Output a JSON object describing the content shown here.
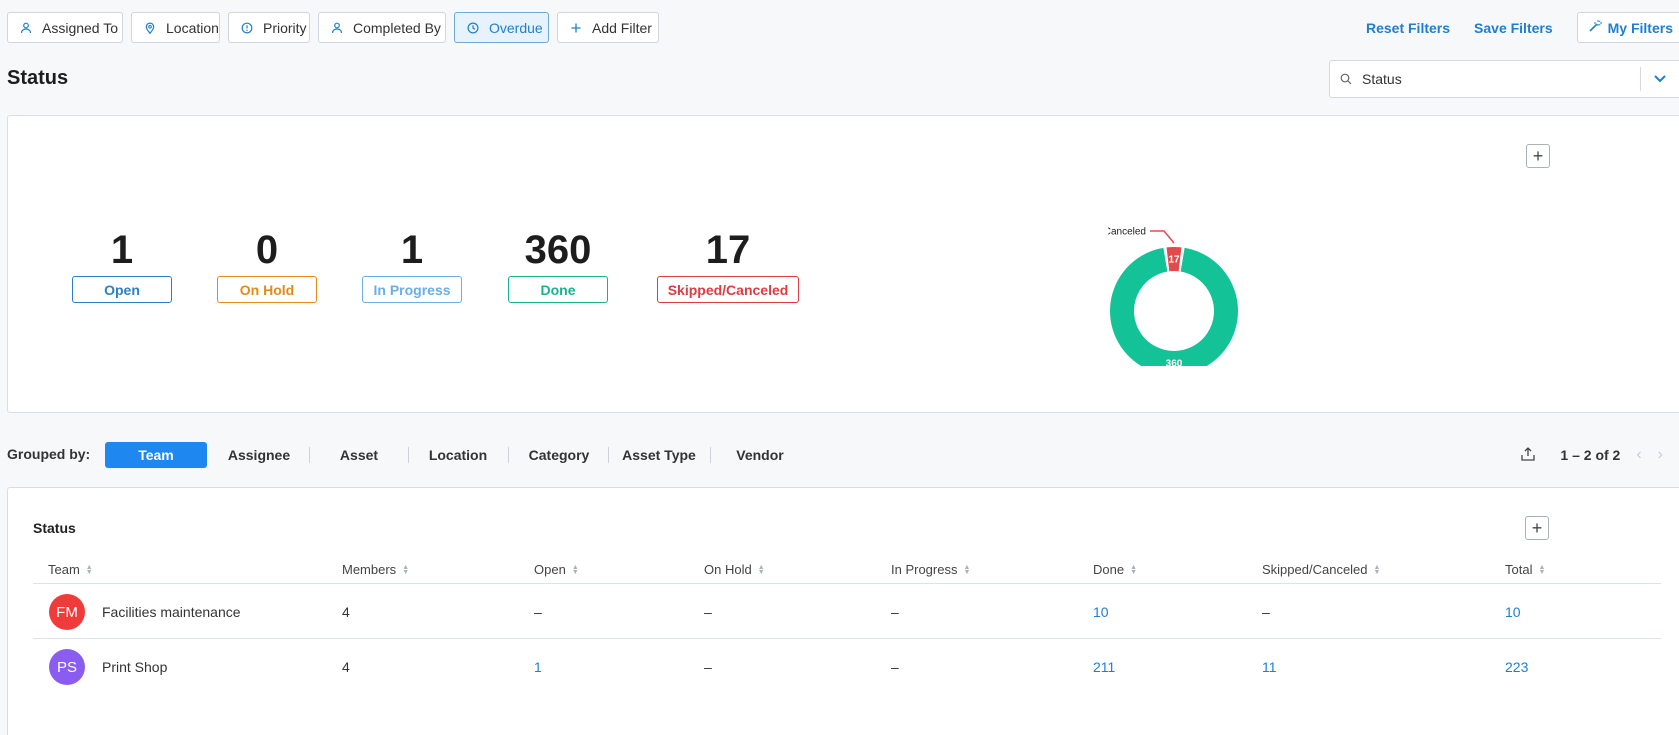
{
  "filters": [
    {
      "label": "Assigned To",
      "icon": "person-icon",
      "active": false
    },
    {
      "label": "Location",
      "icon": "location-pin-icon",
      "active": false
    },
    {
      "label": "Priority",
      "icon": "priority-icon",
      "active": false
    },
    {
      "label": "Completed By",
      "icon": "person-icon",
      "active": false
    },
    {
      "label": "Overdue",
      "icon": "clock-icon",
      "active": true
    },
    {
      "label": "Add Filter",
      "icon": "plus-icon",
      "active": false
    }
  ],
  "top_actions": {
    "reset": "Reset Filters",
    "save": "Save Filters",
    "my_filters": "My Filters"
  },
  "page": {
    "title": "Status",
    "status_select": "Status"
  },
  "summary": {
    "stats": [
      {
        "value": "1",
        "label": "Open",
        "color": "#2b7fc9"
      },
      {
        "value": "0",
        "label": "On Hold",
        "color": "#e58a1a"
      },
      {
        "value": "1",
        "label": "In Progress",
        "color": "#6aaee6"
      },
      {
        "value": "360",
        "label": "Done",
        "color": "#17b38f"
      },
      {
        "value": "17",
        "label": "Skipped/Canceled",
        "color": "#dc3c42"
      }
    ],
    "chart_data": {
      "type": "pie",
      "categories": [
        "Skipped/Canceled",
        "Done"
      ],
      "values": [
        17,
        360
      ],
      "colors": [
        "#e5484d",
        "#14c298"
      ],
      "data_labels": [
        "17",
        "360"
      ],
      "legend": "callout-labels"
    }
  },
  "grouping": {
    "label": "Grouped by:",
    "tabs": [
      "Team",
      "Assignee",
      "Asset",
      "Location",
      "Category",
      "Asset Type",
      "Vendor"
    ],
    "active": "Team",
    "pager": "1 – 2 of 2"
  },
  "table": {
    "title": "Status",
    "columns": [
      "Team",
      "Members",
      "Open",
      "On Hold",
      "In Progress",
      "Done",
      "Skipped/Canceled",
      "Total"
    ],
    "rows": [
      {
        "initials": "FM",
        "avatar_color": "#f03b3b",
        "team": "Facilities maintenance",
        "members": "4",
        "open": "–",
        "on_hold": "–",
        "in_progress": "–",
        "done": "10",
        "skipped": "–",
        "total": "10"
      },
      {
        "initials": "PS",
        "avatar_color": "#8b5cf0",
        "team": "Print Shop",
        "members": "4",
        "open": "1",
        "on_hold": "–",
        "in_progress": "–",
        "done": "211",
        "skipped": "11",
        "total": "223"
      }
    ]
  }
}
